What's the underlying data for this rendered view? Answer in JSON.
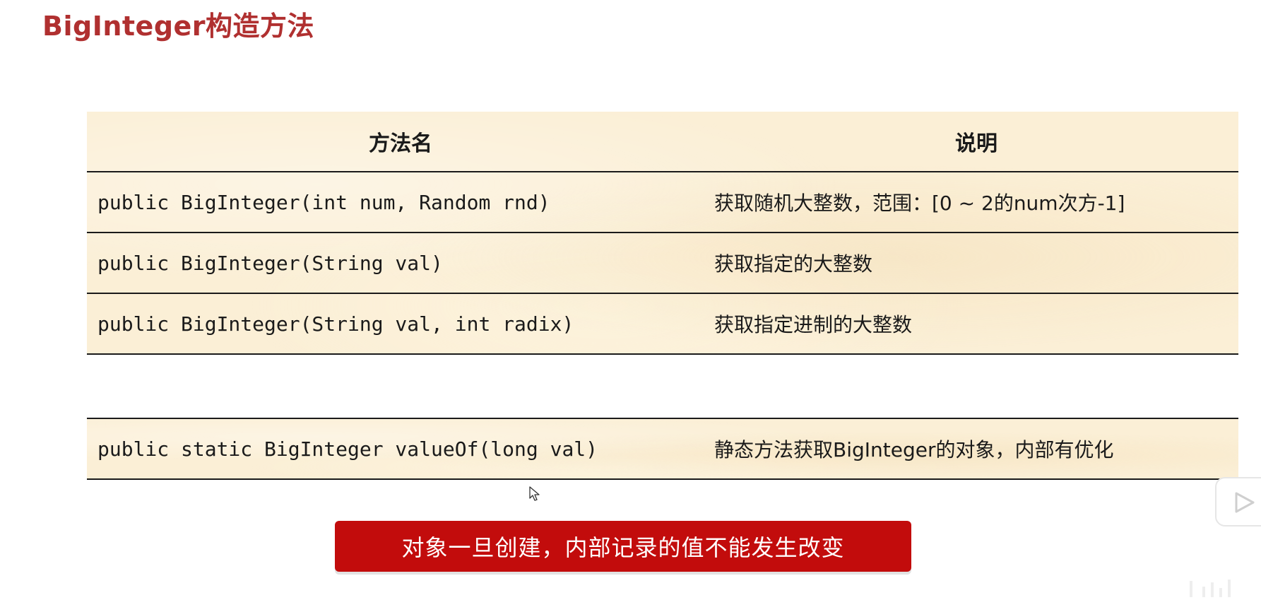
{
  "page": {
    "title": "BigInteger构造方法"
  },
  "table": {
    "headers": {
      "method": "方法名",
      "description": "说明"
    },
    "rows": [
      {
        "method": "public BigInteger(int num, Random rnd)",
        "description": "获取随机大整数，范围：[0 ~ 2的num次方-1]"
      },
      {
        "method": "public BigInteger(String val)",
        "description": "获取指定的大整数"
      },
      {
        "method": "public BigInteger(String val, int radix)",
        "description": "获取指定进制的大整数"
      }
    ]
  },
  "static_method": {
    "method": "public static BigInteger valueOf(long val)",
    "description": "静态方法获取BigInteger的对象，内部有优化"
  },
  "banner": {
    "text": "对象一旦创建，内部记录的值不能发生改变"
  },
  "colors": {
    "title": "#b03030",
    "table_bg": "#fbefd6",
    "banner_bg": "#c20c0c",
    "banner_text": "#ffffff"
  },
  "icons": {
    "cursor": "mouse-cursor-icon",
    "play": "play-icon",
    "watermark": "watermark-icon"
  }
}
